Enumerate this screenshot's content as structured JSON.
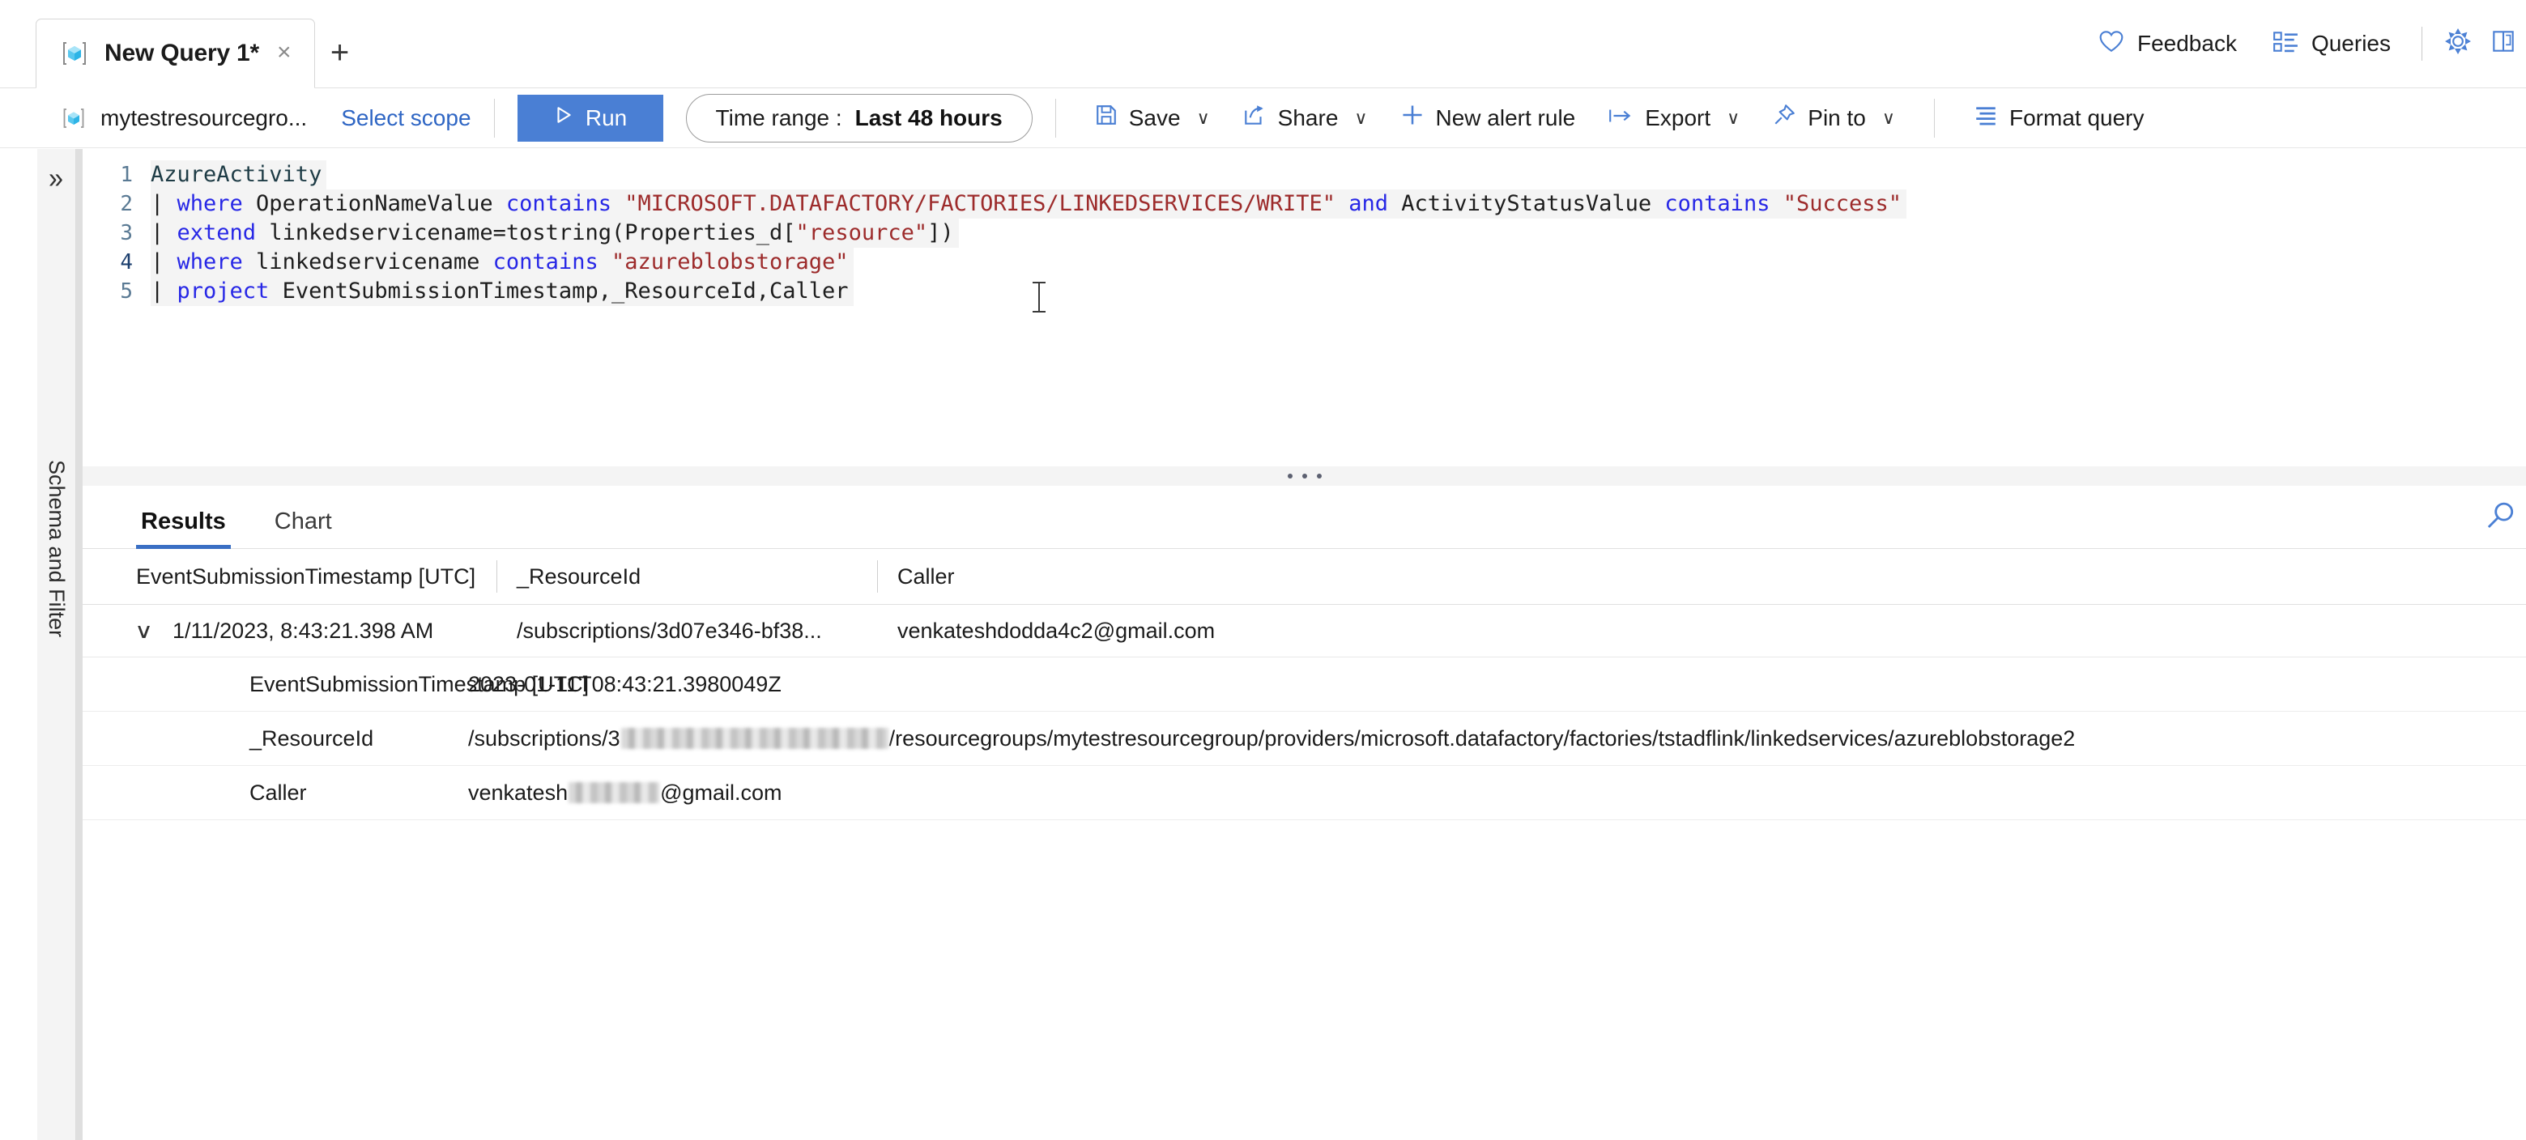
{
  "tabbar": {
    "tab": {
      "label": "New Query 1*",
      "close": "×",
      "icon": "query-cube-icon"
    },
    "new_tab": "+",
    "right_actions": [
      {
        "label": "Feedback",
        "icon": "heart-icon"
      },
      {
        "label": "Queries",
        "icon": "query-list-icon"
      }
    ],
    "right_icons": [
      {
        "icon": "gear-icon"
      },
      {
        "icon": "book-icon"
      }
    ]
  },
  "commandbar": {
    "scope_icon": "scope-cube-icon",
    "scope_name": "mytestresourcegro...",
    "select_scope": "Select scope",
    "run": "Run",
    "time_range_label": "Time range :",
    "time_range_value": "Last 48 hours",
    "buttons": [
      {
        "label": "Save",
        "icon": "save-icon",
        "chevron": "∨"
      },
      {
        "label": "Share",
        "icon": "share-icon",
        "chevron": "∨"
      },
      {
        "label": "New alert rule",
        "icon": "plus-icon",
        "chevron": ""
      },
      {
        "label": "Export",
        "icon": "export-icon",
        "chevron": "∨"
      },
      {
        "label": "Pin to",
        "icon": "pin-icon",
        "chevron": "∨"
      },
      {
        "label": "Format query",
        "icon": "format-icon",
        "chevron": ""
      }
    ]
  },
  "sidebar": {
    "toggle": "»",
    "label": "Schema and Filter"
  },
  "editor": {
    "lines": [
      {
        "n": "1"
      },
      {
        "n": "2"
      },
      {
        "n": "3"
      },
      {
        "n": "4"
      },
      {
        "n": "5"
      }
    ],
    "line1_table": "AzureActivity",
    "line2": {
      "pipe": "| ",
      "kw1": "where",
      "t1": " OperationNameValue ",
      "kw2": "contains",
      "s1": " \"MICROSOFT.DATAFACTORY/FACTORIES/LINKEDSERVICES/WRITE\"",
      "kw3": " and",
      "t2": " ActivityStatusValue ",
      "kw4": "contains",
      "s2": " \"Success\""
    },
    "line3": {
      "pipe": "| ",
      "kw1": "extend",
      "t1": " linkedservicename=tostring(Properties_d[",
      "s1": "\"resource\"",
      "t2": "])"
    },
    "line4": {
      "pipe": "| ",
      "kw1": "where",
      "t1": " linkedservicename ",
      "kw2": "contains",
      "s1": " \"azureblobstorage\""
    },
    "line5": {
      "pipe": "| ",
      "kw1": "project",
      "t1": " EventSubmissionTimestamp,_ResourceId,Caller"
    }
  },
  "results": {
    "tabs": [
      {
        "label": "Results",
        "active": true
      },
      {
        "label": "Chart",
        "active": false
      }
    ],
    "search_icon": "search-icon",
    "columns": [
      "EventSubmissionTimestamp [UTC]",
      "_ResourceId",
      "Caller"
    ],
    "rows": [
      {
        "expander": "∨",
        "timestamp": "1/11/2023, 8:43:21.398 AM",
        "resource_id": "/subscriptions/3d07e346-bf38...",
        "caller": "venkateshdodda4c2@gmail.com"
      }
    ],
    "detail": [
      {
        "key": "EventSubmissionTimestamp [UTC]",
        "value_prefix": "2023-01-11T08:43:21.3980049Z",
        "value_suffix": "",
        "redacted": false
      },
      {
        "key": "_ResourceId",
        "value_prefix": "/subscriptions/3",
        "value_suffix": "/resourcegroups/mytestresourcegroup/providers/microsoft.datafactory/factories/tstadflink/linkedservices/azureblobstorage2",
        "redacted": true,
        "redact_width": 330
      },
      {
        "key": "Caller",
        "value_prefix": "venkatesh",
        "value_suffix": "@gmail.com",
        "redacted": true,
        "redact_width": 112
      }
    ]
  },
  "colors": {
    "accent": "#4a7fd4",
    "link": "#2f66c4",
    "keyword": "#2727e6",
    "string": "#9d2b2b",
    "table_name": "#1d3b45",
    "editor_bg": "#f4f4f4"
  }
}
